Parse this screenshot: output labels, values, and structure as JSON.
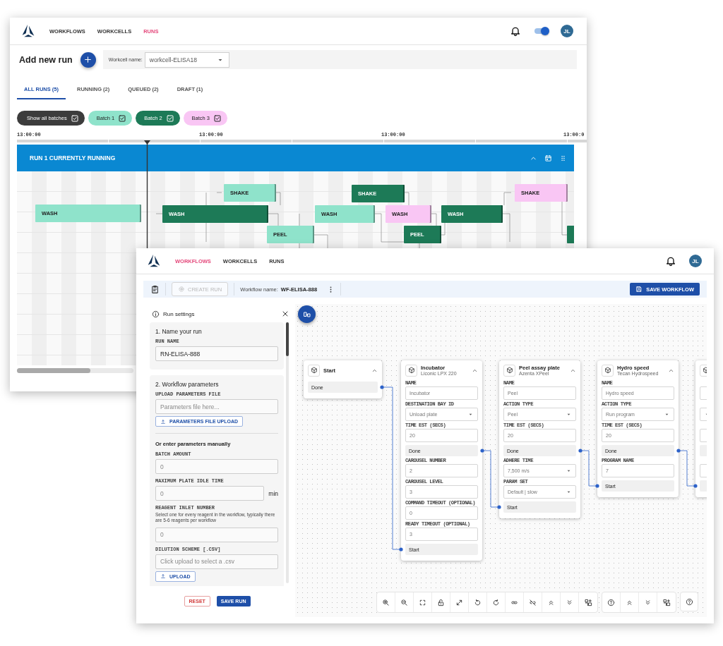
{
  "back_window": {
    "nav": [
      {
        "label": "WORKFLOWS",
        "selected": false
      },
      {
        "label": "WORKCELLS",
        "selected": false
      },
      {
        "label": "RUNS",
        "selected": true
      }
    ],
    "toggle": {
      "on": true
    },
    "avatar": "JL",
    "add_run": {
      "title": "Add new run",
      "workcell_label": "Workcell name:",
      "workcell_value": "workcell-ELISA18"
    },
    "tabs": [
      {
        "label": "ALL RUNS (5)",
        "selected": true
      },
      {
        "label": "RUNNING (2)",
        "selected": false
      },
      {
        "label": "QUEUED (2)",
        "selected": false
      },
      {
        "label": "DRAFT (1)",
        "selected": false
      }
    ],
    "chips": [
      {
        "kind": "all",
        "label": "Show all batches",
        "checked": true,
        "color": "#3c3c3c"
      },
      {
        "kind": "batch",
        "label": "Batch 1",
        "checked": true,
        "color": "#8fe3cb"
      },
      {
        "kind": "batch",
        "label": "Batch 2",
        "checked": true,
        "color": "#1d7a57"
      },
      {
        "kind": "batch",
        "label": "Batch 3",
        "checked": true,
        "color": "#f9c6f4"
      }
    ],
    "ticks": [
      "13:00:00",
      "13:00:00",
      "13:00:00",
      "13:00:0"
    ],
    "banner": {
      "title": "RUN 1 CURRENTLY RUNNING"
    },
    "bars": [
      {
        "label": "WASH",
        "color": "#8fe3cb"
      },
      {
        "label": "WASH",
        "color": "#1d7a57"
      },
      {
        "label": "SHAKE",
        "color": "#8fe3cb"
      },
      {
        "label": "PEEL",
        "color": "#8fe3cb"
      },
      {
        "label": "SHAKE",
        "color": "#1d7a57"
      },
      {
        "label": "WASH",
        "color": "#8fe3cb"
      },
      {
        "label": "WASH",
        "color": "#f9c6f4"
      },
      {
        "label": "PEEL",
        "color": "#1d7a57"
      },
      {
        "label": "WASH",
        "color": "#1d7a57"
      },
      {
        "label": "SHAKE",
        "color": "#f9c6f4"
      },
      {
        "color": "#1d7a57"
      }
    ]
  },
  "front_window": {
    "nav": [
      {
        "label": "WORKFLOWS",
        "selected": true
      },
      {
        "label": "WORKCELLS",
        "selected": false
      },
      {
        "label": "RUNS",
        "selected": false
      }
    ],
    "avatar": "JL",
    "toolbar": {
      "create_run": {
        "label": "CREATE RUN",
        "disabled": true
      },
      "workflow_label": "Workflow name:",
      "workflow_name": "WF-ELISA-888",
      "save": "SAVE WORKFLOW"
    },
    "run_settings": {
      "title": "Run settings",
      "sections": [
        {
          "title": "1. Name your run",
          "items": [
            {
              "kind": "field",
              "label": "RUN NAME",
              "value": "RN-ELISA-888"
            }
          ]
        },
        {
          "title": "2. Workflow parameters",
          "items": [
            {
              "kind": "field",
              "label": "UPLOAD PARAMETERS FILE",
              "placeholder": "Parameters file here..."
            },
            {
              "kind": "upload",
              "label": "PARAMETERS FILE UPLOAD"
            },
            {
              "kind": "divider"
            },
            {
              "kind": "heading",
              "label": "Or enter parameters manually"
            },
            {
              "kind": "field",
              "label": "BATCH AMOUNT",
              "placeholder": "0"
            },
            {
              "kind": "field",
              "label": "MAXIMUM PLATE IDLE TIME",
              "placeholder": "0",
              "unit": "min"
            },
            {
              "kind": "field",
              "label": "REAGENT INLET NUMBER",
              "help": "Select one for every reagent in the workflow, typically there are 5-6 reagents per workflow",
              "placeholder": "0"
            },
            {
              "kind": "field",
              "label": "DILUTION SCHEME [.CSV]",
              "placeholder": "Click upload to select a .csv"
            },
            {
              "kind": "upload",
              "label": "UPLOAD"
            }
          ]
        }
      ],
      "reset": "RESET",
      "save": "SAVE RUN"
    },
    "canvas": {
      "nodes": [
        {
          "title": "Start",
          "items": [
            {
              "kind": "out_port",
              "label": "Done"
            }
          ]
        },
        {
          "title": "Incubator",
          "subtitle": "Liconic LPX 220",
          "items": [
            {
              "kind": "text",
              "label": "NAME",
              "value": "Incubator"
            },
            {
              "kind": "select",
              "label": "DESTINATION BAY ID",
              "value": "Unload plate"
            },
            {
              "kind": "text",
              "label": "TIME EST (SECS)",
              "value": "20"
            },
            {
              "kind": "out_port",
              "label": "Done"
            },
            {
              "kind": "text",
              "label": "CAROUSEL NUMBER",
              "value": "2"
            },
            {
              "kind": "text",
              "label": "CAROUSEL LEVEL",
              "value": "3"
            },
            {
              "kind": "text",
              "label": "COMMAND TIMEOUT (OPTIONAL)",
              "value": "0"
            },
            {
              "kind": "text",
              "label": "READY TIMEOUT (OPTIONAL)",
              "value": "3"
            },
            {
              "kind": "in_port",
              "label": "Start"
            }
          ]
        },
        {
          "title": "Peel assay plate",
          "subtitle": "Azenta XPeel",
          "items": [
            {
              "kind": "text",
              "label": "NAME",
              "value": "Peel"
            },
            {
              "kind": "select",
              "label": "ACTION TYPE",
              "value": "Peel"
            },
            {
              "kind": "text",
              "label": "TIME EST (SECS)",
              "value": "20"
            },
            {
              "kind": "out_port",
              "label": "Done"
            },
            {
              "kind": "select",
              "label": "ADHERE TIME",
              "value": "7,500 m/s"
            },
            {
              "kind": "select",
              "label": "PARAM SET",
              "value": "Default | slow"
            },
            {
              "kind": "in_port",
              "label": "Start"
            }
          ]
        },
        {
          "title": "Hydro speed",
          "subtitle": "Tecan Hydrospeed",
          "items": [
            {
              "kind": "text",
              "label": "NAME",
              "value": "Hydro speed"
            },
            {
              "kind": "select",
              "label": "ACTION TYPE",
              "value": "Run program"
            },
            {
              "kind": "text",
              "label": "TIME EST (SECS)",
              "value": "20"
            },
            {
              "kind": "out_port",
              "label": "Done"
            },
            {
              "kind": "text",
              "label": "PROGRAM NAME",
              "value": "7"
            },
            {
              "kind": "in_port",
              "label": "Start"
            }
          ]
        },
        {
          "items": [
            {
              "kind": "text"
            },
            {
              "kind": "select"
            },
            {
              "kind": "text"
            },
            {
              "kind": "out_port"
            },
            {
              "kind": "text"
            },
            {
              "kind": "in_port"
            }
          ]
        }
      ]
    }
  }
}
